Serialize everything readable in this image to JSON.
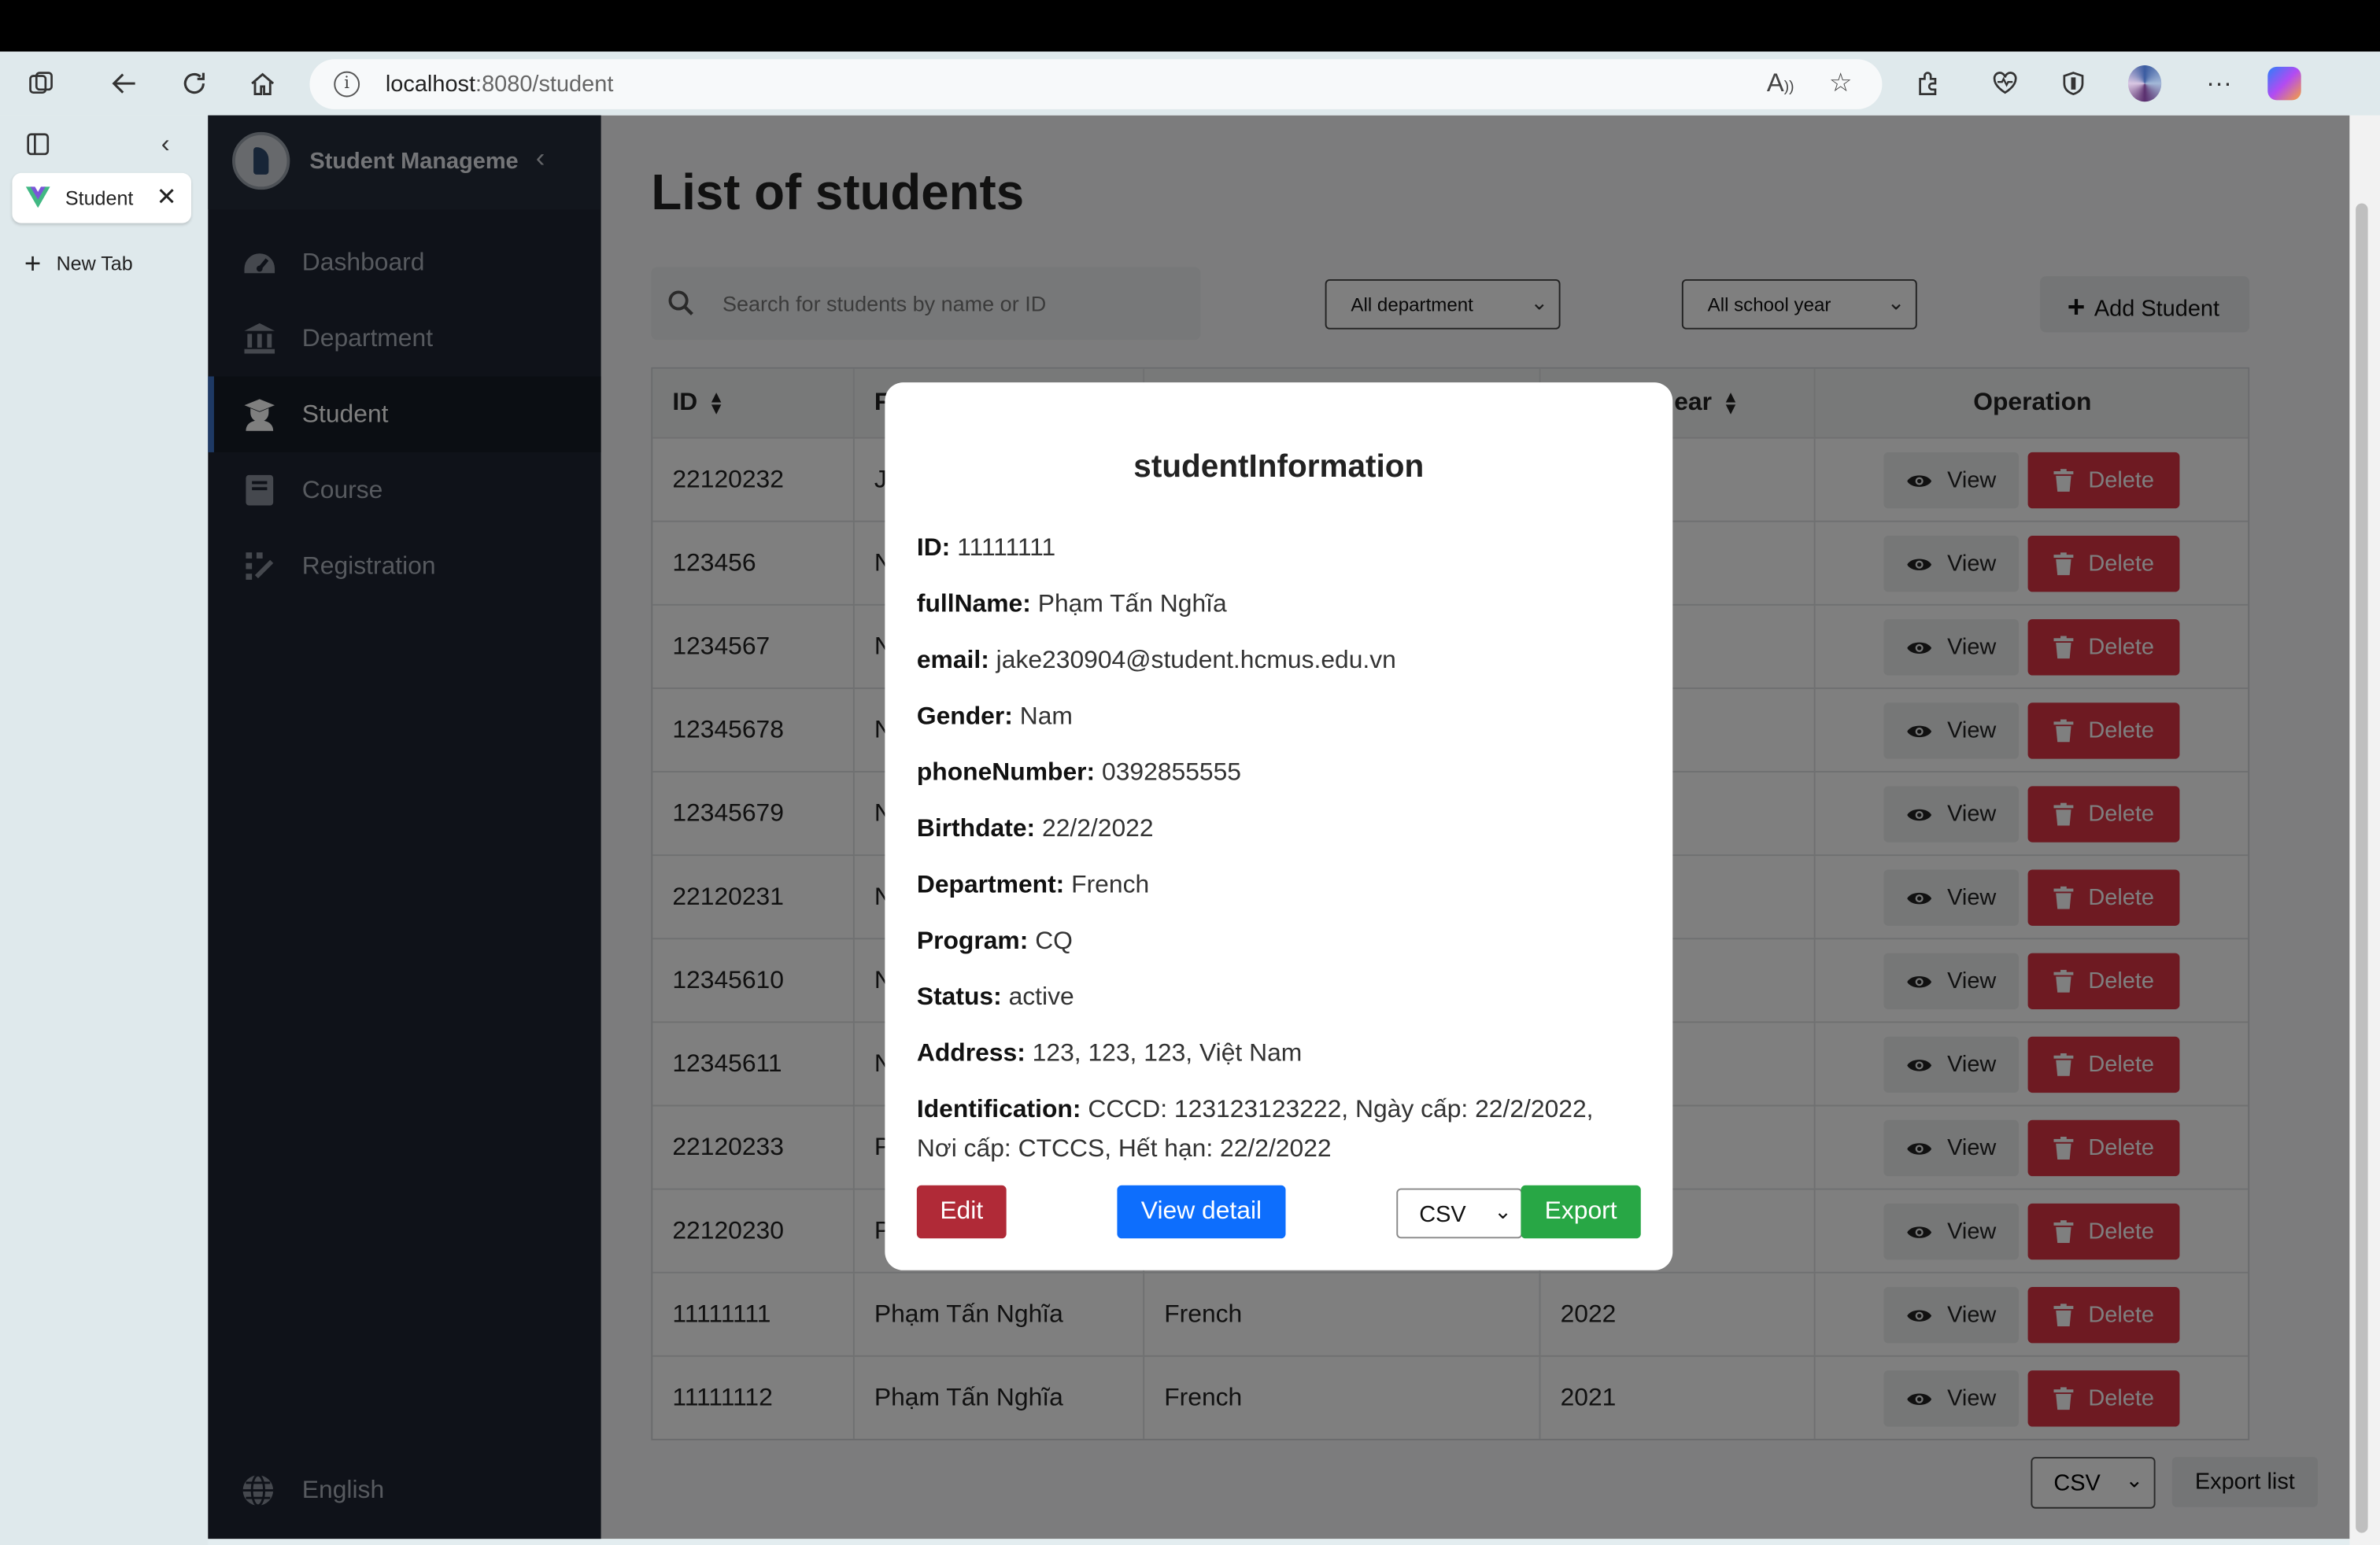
{
  "browser": {
    "url_host": "localhost",
    "url_rest": ":8080/student",
    "tab_label": "Student M",
    "new_tab_label": "New Tab"
  },
  "sidebar": {
    "title": "Student Management",
    "items": [
      {
        "label": "Dashboard",
        "icon": "gauge-icon"
      },
      {
        "label": "Department",
        "icon": "institution-icon"
      },
      {
        "label": "Student",
        "icon": "student-icon",
        "active": true
      },
      {
        "label": "Course",
        "icon": "book-icon"
      },
      {
        "label": "Registration",
        "icon": "registration-icon"
      }
    ],
    "language": "English"
  },
  "main": {
    "title": "List of students",
    "search_placeholder": "Search for students by name or ID",
    "department_filter": "All department",
    "year_filter": "All school year",
    "add_button": "Add Student",
    "columns": [
      "ID",
      "F",
      "",
      "ear",
      "Operation"
    ],
    "rows": [
      {
        "id": "22120232",
        "name": "J",
        "dept": "",
        "year": ""
      },
      {
        "id": "123456",
        "name": "N",
        "dept": "",
        "year": ""
      },
      {
        "id": "1234567",
        "name": "N",
        "dept": "",
        "year": ""
      },
      {
        "id": "12345678",
        "name": "N",
        "dept": "",
        "year": ""
      },
      {
        "id": "12345679",
        "name": "N",
        "dept": "",
        "year": ""
      },
      {
        "id": "22120231",
        "name": "N",
        "dept": "",
        "year": ""
      },
      {
        "id": "12345610",
        "name": "N",
        "dept": "",
        "year": ""
      },
      {
        "id": "12345611",
        "name": "N",
        "dept": "",
        "year": ""
      },
      {
        "id": "22120233",
        "name": "P",
        "dept": "",
        "year": ""
      },
      {
        "id": "22120230",
        "name": "P",
        "dept": "",
        "year": ""
      },
      {
        "id": "11111111",
        "name": "Phạm Tấn Nghĩa",
        "dept": "French",
        "year": "2022"
      },
      {
        "id": "11111112",
        "name": "Phạm Tấn Nghĩa",
        "dept": "French",
        "year": "2021"
      }
    ],
    "view_label": "View",
    "delete_label": "Delete",
    "export_format": "CSV",
    "export_list_label": "Export list"
  },
  "modal": {
    "title": "studentInformation",
    "fields": [
      {
        "key": "ID:",
        "value": "11111111"
      },
      {
        "key": "fullName:",
        "value": "Phạm Tấn Nghĩa"
      },
      {
        "key": "email:",
        "value": "jake230904@student.hcmus.edu.vn"
      },
      {
        "key": "Gender:",
        "value": "Nam"
      },
      {
        "key": "phoneNumber:",
        "value": "0392855555"
      },
      {
        "key": "Birthdate:",
        "value": "22/2/2022"
      },
      {
        "key": "Department:",
        "value": "French"
      },
      {
        "key": "Program:",
        "value": "CQ"
      },
      {
        "key": "Status:",
        "value": "active"
      },
      {
        "key": "Address:",
        "value": "123, 123, 123, Việt Nam"
      },
      {
        "key": "Identification:",
        "value": "CCCD: 123123123222, Ngày cấp: 22/2/2022, Nơi cấp: CTCCS, Hết hạn: 22/2/2022"
      }
    ],
    "edit_label": "Edit",
    "view_detail_label": "View detail",
    "format": "CSV",
    "export_label": "Export"
  },
  "colors": {
    "sidebar_bg": "#1e2533",
    "delete": "#dc3545",
    "edit": "#b02a37",
    "view_detail": "#0d6efd",
    "export": "#28a745"
  }
}
